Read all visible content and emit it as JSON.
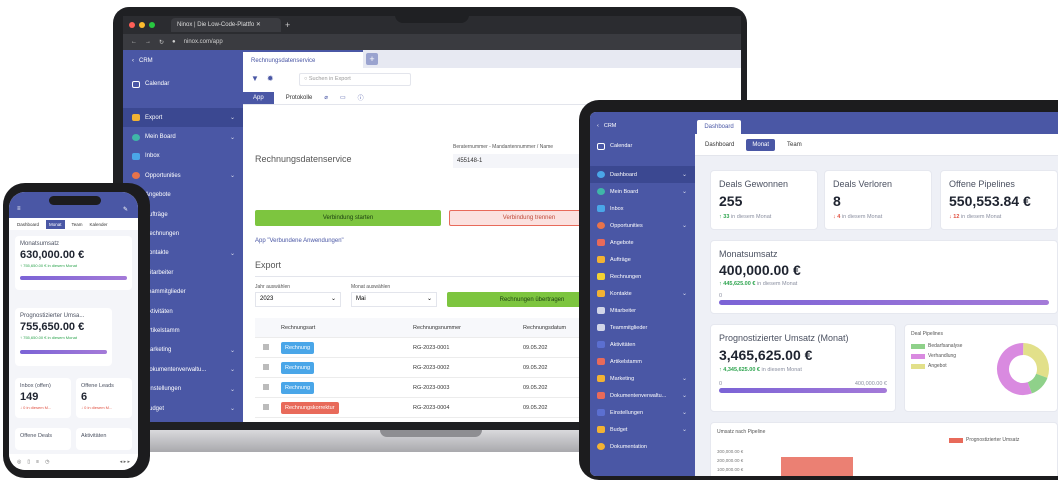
{
  "laptop": {
    "browser_tab_title": "Ninox | Die Low-Code-Plattfo",
    "url": "ninox.com/app",
    "sidebar_header": "CRM",
    "sidebar_items": [
      {
        "label": "Calendar"
      },
      {
        "label": "Export"
      },
      {
        "label": "Mein Board"
      },
      {
        "label": "Inbox"
      },
      {
        "label": "Opportunities"
      },
      {
        "label": "Angebote"
      },
      {
        "label": "Aufträge"
      },
      {
        "label": "Rechnungen"
      },
      {
        "label": "Kontakte"
      },
      {
        "label": "Mitarbeiter"
      },
      {
        "label": "Teammitglieder"
      },
      {
        "label": "Aktivitäten"
      },
      {
        "label": "Artikelstamm"
      },
      {
        "label": "Marketing"
      },
      {
        "label": "Dokumentenverwaltu..."
      },
      {
        "label": "Einstellungen"
      },
      {
        "label": "Budget"
      }
    ],
    "open_tab": "Rechnungsdatenservice",
    "search_placeholder": "Suchen in Export",
    "subtab_app": "App",
    "subtab_protokolle": "Protokolle",
    "form_title": "Rechnungsdatenservice",
    "berater_label": "Beraternummer - Mandantennummer / Name",
    "berater_value": "455148-1",
    "btn_connect": "Verbindung starten",
    "btn_disconnect": "Verbindung trennen",
    "link_apps": "App \"Verbundene Anwendungen\"",
    "export_title": "Export",
    "year_label": "Jahr auswählen",
    "year_value": "2023",
    "month_label": "Monat auswählen",
    "month_value": "Mai",
    "btn_transfer": "Rechnungen übertragen",
    "table_headers": [
      "Rechnungsart",
      "Rechnungsnummer",
      "Rechnungsdatum"
    ],
    "table_rows": [
      {
        "type": "Rechnung",
        "number": "RG-2023-0001",
        "date": "09.05.202"
      },
      {
        "type": "Rechnung",
        "number": "RG-2023-0002",
        "date": "09.05.202"
      },
      {
        "type": "Rechnung",
        "number": "RG-2023-0003",
        "date": "09.05.202"
      },
      {
        "type": "Rechnungskorrektur",
        "number": "RG-2023-0004",
        "date": "09.05.202"
      }
    ]
  },
  "phone": {
    "tabs": [
      "Dashboard",
      "Monat",
      "Team",
      "Kalender"
    ],
    "monatsumsatz_label": "Monatsumsatz",
    "monatsumsatz_value": "630,000.00 €",
    "monatsumsatz_sub": "↑ 755,650.00 € in diesem Monat",
    "monatsumsatz_progress": 1.0,
    "prognose_label": "Prognostizierter Umsa...",
    "prognose_value": "755,650.00 €",
    "prognose_sub": "↑ 755,650.00 € in diesem Monat",
    "prognose_progress": 1.0,
    "inbox_label": "Inbox (offen)",
    "inbox_value": "149",
    "inbox_sub": "↓ 0 in diesem M...",
    "leads_label": "Offene Leads",
    "leads_value": "6",
    "leads_sub": "↓ 0 in diesem M...",
    "deals_label": "Offene Deals",
    "aktivitaeten_label": "Aktivitäten"
  },
  "tablet": {
    "sidebar_header": "CRM",
    "sidebar_items": [
      {
        "label": "Calendar"
      },
      {
        "label": "Dashboard"
      },
      {
        "label": "Mein Board"
      },
      {
        "label": "Inbox"
      },
      {
        "label": "Opportunities"
      },
      {
        "label": "Angebote"
      },
      {
        "label": "Aufträge"
      },
      {
        "label": "Rechnungen"
      },
      {
        "label": "Kontakte"
      },
      {
        "label": "Mitarbeiter"
      },
      {
        "label": "Teammitglieder"
      },
      {
        "label": "Aktivitäten"
      },
      {
        "label": "Artikelstamm"
      },
      {
        "label": "Marketing"
      },
      {
        "label": "Dokumentenverwaltu..."
      },
      {
        "label": "Einstellungen"
      },
      {
        "label": "Budget"
      },
      {
        "label": "Dokumentation"
      }
    ],
    "top_tab": "Dashboard",
    "subtabs": [
      "Dashboard",
      "Monat",
      "Team"
    ],
    "kpis": [
      {
        "label": "Deals Gewonnen",
        "value": "255",
        "trend": "↑ 33",
        "trend_text": "in diesem Monat"
      },
      {
        "label": "Deals Verloren",
        "value": "8",
        "trend": "↓ 4",
        "trend_text": "in diesem Monat"
      },
      {
        "label": "Offene Pipelines",
        "value": "550,553.84 €",
        "trend": "↓ 12",
        "trend_text": "in diesem Monat"
      }
    ],
    "monatsumsatz_label": "Monatsumsatz",
    "monatsumsatz_value": "400,000.00 €",
    "monatsumsatz_trend": "↑ 445,625.00 €",
    "monatsumsatz_trend_text": "in diesem Monat",
    "monatsumsatz_axis_start": "0",
    "monatsumsatz_progress": 1.0,
    "prognose_label": "Prognostizierter Umsatz (Monat)",
    "prognose_value": "3,465,625.00 €",
    "prognose_trend": "↑ 4,345,625.00 €",
    "prognose_trend_text": "in diesem Monat",
    "prognose_axis_start": "0",
    "prognose_axis_end": "400,000.00 €",
    "prognose_progress": 1.0,
    "deal_pipelines_title": "Deal Pipelines",
    "legend": [
      {
        "label": "Bedarfsanalyse",
        "color": "#8fd18a"
      },
      {
        "label": "Verhandlung",
        "color": "#d98ae0"
      },
      {
        "label": "Angebot",
        "color": "#e2e08a"
      }
    ],
    "umsatz_title": "Umsatz nach Pipeline",
    "umsatz_legend": "Prognostizierter Umsatz",
    "umsatz_ticks": [
      "300,000.00 €",
      "200,000.00 €",
      "100,000.00 €"
    ]
  },
  "colors": {
    "sidebar": "#4a57a5",
    "green": "#7dc53f",
    "red": "#e86a5a",
    "blue_tag": "#4aa6e8",
    "accent": "#7b63d6"
  }
}
